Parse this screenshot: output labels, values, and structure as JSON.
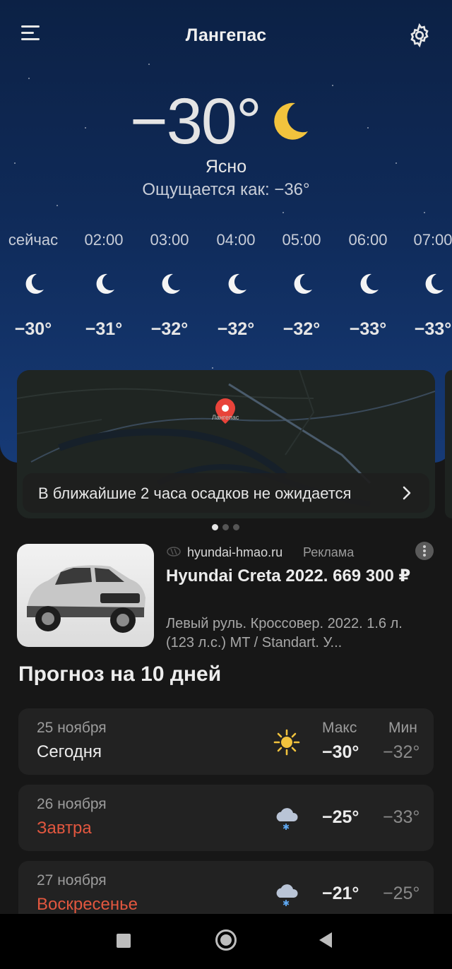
{
  "header": {
    "city": "Лангепас"
  },
  "current": {
    "temperature": "−30°",
    "condition": "Ясно",
    "feels_like": "Ощущается как: −36°",
    "icon": "moon-icon"
  },
  "hourly": [
    {
      "time": "сейчас",
      "temp": "−30°",
      "icon": "moon-icon"
    },
    {
      "time": "02:00",
      "temp": "−31°",
      "icon": "moon-icon"
    },
    {
      "time": "03:00",
      "temp": "−32°",
      "icon": "moon-icon"
    },
    {
      "time": "04:00",
      "temp": "−32°",
      "icon": "moon-icon"
    },
    {
      "time": "05:00",
      "temp": "−32°",
      "icon": "moon-icon"
    },
    {
      "time": "06:00",
      "temp": "−33°",
      "icon": "moon-icon"
    },
    {
      "time": "07:00",
      "temp": "−33°",
      "icon": "moon-icon"
    }
  ],
  "map": {
    "place_label": "Лангепас",
    "precipitation_text": "В ближайшие 2 часа осадков не ожидается",
    "page_count": 3,
    "active_page": 1
  },
  "ad": {
    "domain": "hyundai-hmao.ru",
    "label": "Реклама",
    "title": "Hyundai Creta 2022. 669 300 ₽",
    "description": "Левый руль. Кроссовер. 2022. 1.6 л. (123 л.с.) MT / Standart. У..."
  },
  "forecast": {
    "title": "Прогноз на 10 дней",
    "max_label": "Макс",
    "min_label": "Мин",
    "days": [
      {
        "date": "25 ноября",
        "name": "Сегодня",
        "max": "−30°",
        "min": "−32°",
        "icon": "sun-icon",
        "weekend": false
      },
      {
        "date": "26 ноября",
        "name": "Завтра",
        "max": "−25°",
        "min": "−33°",
        "icon": "cloud-snow-icon",
        "weekend": true
      },
      {
        "date": "27 ноября",
        "name": "Воскресенье",
        "max": "−21°",
        "min": "−25°",
        "icon": "cloud-snow-icon",
        "weekend": true
      }
    ]
  },
  "colors": {
    "sky_top": "#0c2145",
    "sky_bottom": "#163a76",
    "weekend_red": "#e2573f",
    "background": "#171717",
    "card": "#222222"
  }
}
